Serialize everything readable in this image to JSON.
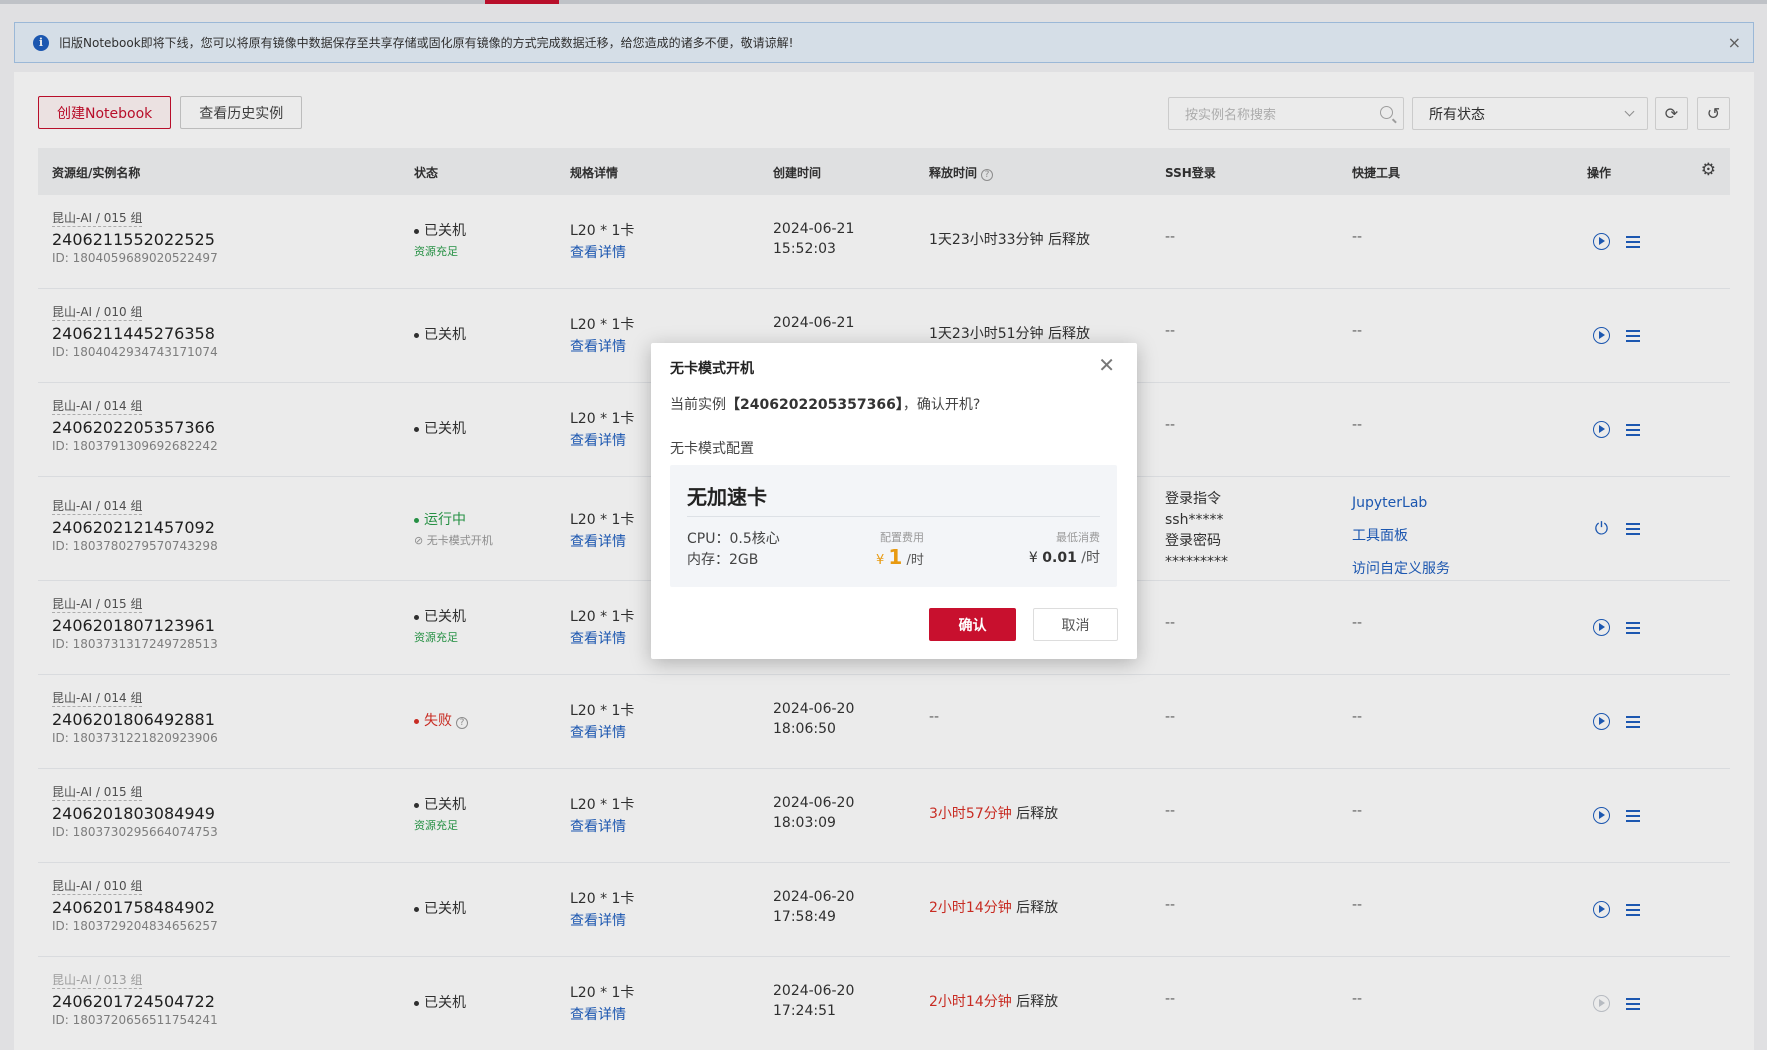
{
  "notice": {
    "text": "旧版Notebook即将下线，您可以将原有镜像中数据保存至共享存储或固化原有镜像的方式完成数据迁移，给您造成的诸多不便，敬请谅解!",
    "info_glyph": "i",
    "close_glyph": "×"
  },
  "toolbar": {
    "create_label": "创建Notebook",
    "history_label": "查看历史实例",
    "search_placeholder": "按实例名称搜索",
    "status_select": "所有状态",
    "refresh_glyph": "⟳",
    "reset_glyph": "↺"
  },
  "table": {
    "headers": {
      "name": "资源组/实例名称",
      "status": "状态",
      "spec": "规格详情",
      "created": "创建时间",
      "release": "释放时间",
      "ssh": "SSH登录",
      "tools": "快捷工具",
      "ops": "操作"
    },
    "settings_glyph": "⚙",
    "help_glyph": "?",
    "rows": [
      {
        "group": "昆山-AI / 015 组",
        "name": "2406211552022525",
        "id": "ID: 1804059689020522497",
        "status": "已关机",
        "status_sub": "资源充足",
        "spec": "L20 * 1卡",
        "spec_link": "查看详情",
        "created_date": "2024-06-21",
        "created_time": "15:52:03",
        "release_red": "",
        "release": "1天23小时33分钟 后释放",
        "ssh": "--",
        "tools": "--"
      },
      {
        "group": "昆山-AI / 010 组",
        "name": "2406211445276358",
        "id": "ID: 1804042934743171074",
        "status": "已关机",
        "status_sub": "",
        "spec": "L20 * 1卡",
        "spec_link": "查看详情",
        "created_date": "2024-06-21",
        "created_time": "",
        "release_red": "",
        "release": "1天23小时51分钟 后释放",
        "ssh": "--",
        "tools": "--"
      },
      {
        "group": "昆山-AI / 014 组",
        "name": "2406202205357366",
        "id": "ID: 1803791309692682242",
        "status": "已关机",
        "status_sub": "",
        "spec": "L20 * 1卡",
        "spec_link": "查看详情",
        "created_date": "",
        "created_time": "",
        "release_red": "",
        "release": "",
        "ssh": "--",
        "tools": "--"
      },
      {
        "group": "昆山-AI / 014 组",
        "name": "2406202121457092",
        "id": "ID: 1803780279570743298",
        "status": "运行中",
        "status_sub": "⊘ 无卡模式开机",
        "spec": "L20 * 1卡",
        "spec_link": "查看详情",
        "created_date": "",
        "created_time": "",
        "release_red": "",
        "release": "",
        "ssh_lines": [
          "登录指令",
          "ssh*****",
          "登录密码",
          "*********"
        ],
        "tools_links": [
          "JupyterLab",
          "工具面板",
          "访问自定义服务"
        ]
      },
      {
        "group": "昆山-AI / 015 组",
        "name": "2406201807123961",
        "id": "ID: 1803731317249728513",
        "status": "已关机",
        "status_sub": "资源充足",
        "spec": "L20 * 1卡",
        "spec_link": "查看详情",
        "created_date": "",
        "created_time": "",
        "release_red": "",
        "release": "",
        "ssh": "--",
        "tools": "--"
      },
      {
        "group": "昆山-AI / 014 组",
        "name": "2406201806492881",
        "id": "ID: 1803731221820923906",
        "status": "失败",
        "status_sub": "",
        "spec": "L20 * 1卡",
        "spec_link": "查看详情",
        "created_date": "2024-06-20",
        "created_time": "18:06:50",
        "release_red": "",
        "release": "--",
        "ssh": "--",
        "tools": "--"
      },
      {
        "group": "昆山-AI / 015 组",
        "name": "2406201803084949",
        "id": "ID: 1803730295664074753",
        "status": "已关机",
        "status_sub": "资源充足",
        "spec": "L20 * 1卡",
        "spec_link": "查看详情",
        "created_date": "2024-06-20",
        "created_time": "18:03:09",
        "release_red": "3小时57分钟",
        "release": " 后释放",
        "ssh": "--",
        "tools": "--"
      },
      {
        "group": "昆山-AI / 010 组",
        "name": "2406201758484902",
        "id": "ID: 1803729204834656257",
        "status": "已关机",
        "status_sub": "",
        "spec": "L20 * 1卡",
        "spec_link": "查看详情",
        "created_date": "2024-06-20",
        "created_time": "17:58:49",
        "release_red": "2小时14分钟",
        "release": " 后释放",
        "ssh": "--",
        "tools": "--"
      },
      {
        "group": "昆山-AI / 013 组",
        "name": "2406201724504722",
        "id": "ID: 1803720656511754241",
        "status": "已关机",
        "status_sub": "",
        "spec": "L20 * 1卡",
        "spec_link": "查看详情",
        "created_date": "2024-06-20",
        "created_time": "17:24:51",
        "release_red": "2小时14分钟",
        "release": " 后释放",
        "ssh": "--",
        "tools": "--"
      }
    ]
  },
  "modal": {
    "title": "无卡模式开机",
    "close_glyph": "✕",
    "confirm_prefix": "当前实例",
    "confirm_instance": "【2406202205357366】",
    "confirm_suffix": "，确认开机?",
    "config_label": "无卡模式配置",
    "card_title": "无加速卡",
    "cpu": "CPU：0.5核心",
    "memory": "内存：2GB",
    "fee_label": "配置费用",
    "fee_currency": "¥",
    "fee_value": "1",
    "fee_unit": "/时",
    "min_label": "最低消费",
    "min_currency": "¥",
    "min_value": "0.01",
    "min_unit": "/时",
    "ok_label": "确认",
    "cancel_label": "取消"
  },
  "colors": {
    "brand_red": "#c8102e",
    "link_blue": "#1f5fbf",
    "success_green": "#2a9d4a",
    "fee_orange": "#e89a11"
  }
}
